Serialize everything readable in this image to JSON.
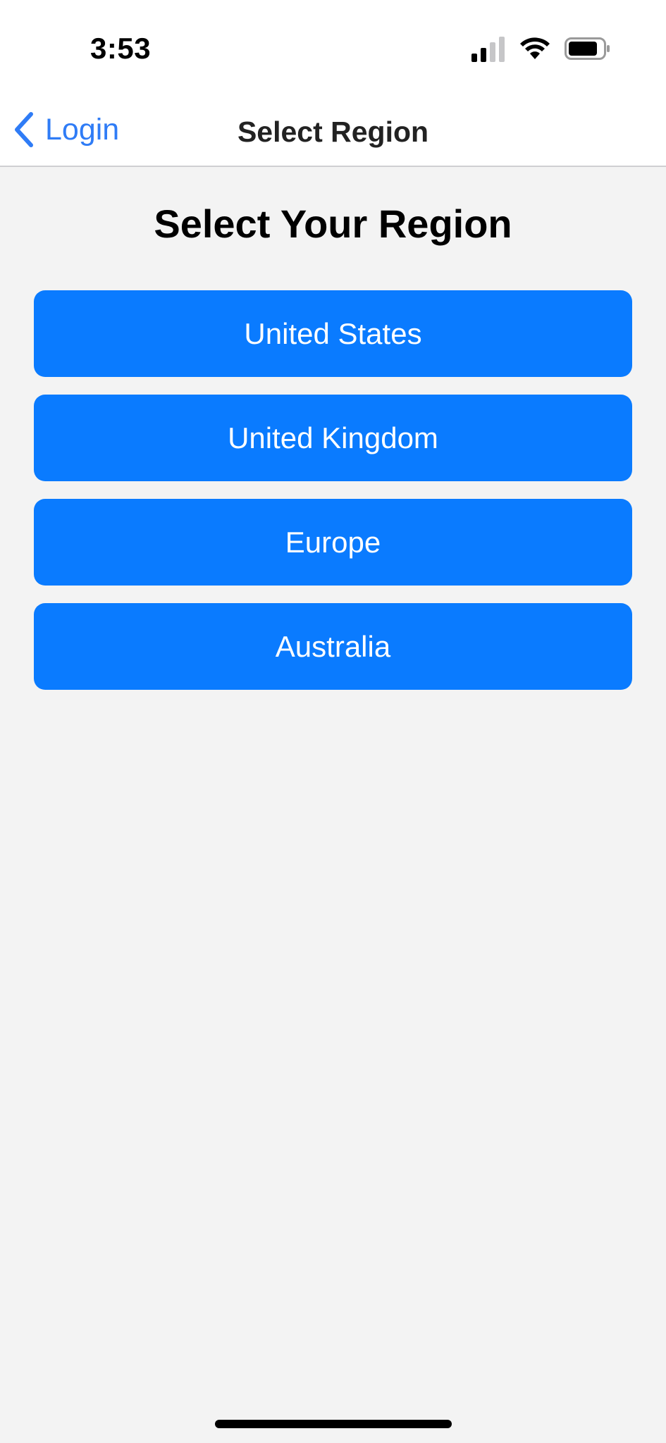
{
  "status_bar": {
    "time": "3:53",
    "icons": [
      "cellular-signal-icon",
      "wifi-icon",
      "battery-icon"
    ]
  },
  "nav": {
    "back_label": "Login",
    "title": "Select Region"
  },
  "page": {
    "heading": "Select Your Region"
  },
  "regions": [
    {
      "label": "United States"
    },
    {
      "label": "United Kingdom"
    },
    {
      "label": "Europe"
    },
    {
      "label": "Australia"
    }
  ],
  "colors": {
    "accent": "#0a7bff",
    "link": "#2f7cf6",
    "background": "#f3f3f3",
    "header_background": "#ffffff"
  }
}
